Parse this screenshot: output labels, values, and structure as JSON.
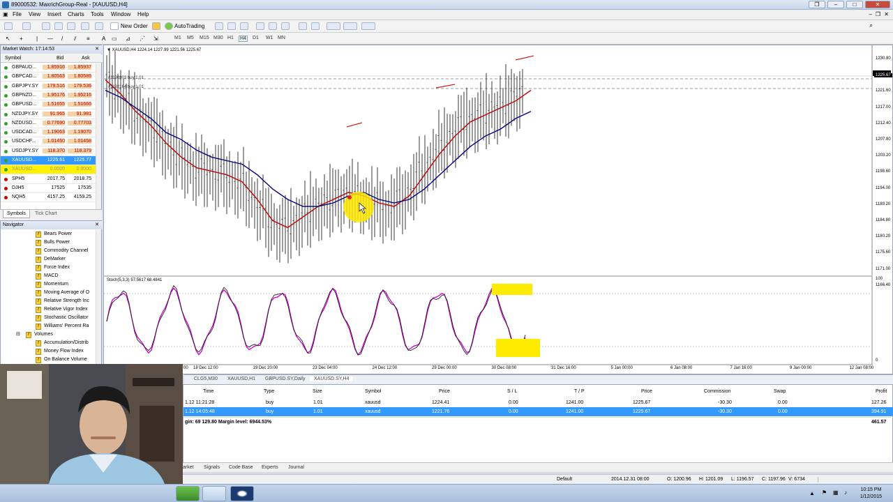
{
  "window": {
    "title": "89000532: MaxrichGroup-Real - [XAUUSD,H4]"
  },
  "menu": [
    "File",
    "View",
    "Insert",
    "Charts",
    "Tools",
    "Window",
    "Help"
  ],
  "toolbar": {
    "new_order": "New Order",
    "autotrading": "AutoTrading"
  },
  "timeframes": [
    "M1",
    "M5",
    "M15",
    "M30",
    "H1",
    "H4",
    "D1",
    "W1",
    "MN"
  ],
  "market_watch": {
    "title": "Market Watch: 17:14:53",
    "columns": [
      "Symbol",
      "Bid",
      "Ask"
    ],
    "rows": [
      {
        "symbol": "GBPAUD...",
        "bid": "1.85916",
        "ask": "1.85937"
      },
      {
        "symbol": "GBPCAD...",
        "bid": "1.80563",
        "ask": "1.80586"
      },
      {
        "symbol": "GBPJPY.SY",
        "bid": "179.516",
        "ask": "179.536"
      },
      {
        "symbol": "GBPNZD...",
        "bid": "1.95176",
        "ask": "1.95216"
      },
      {
        "symbol": "GBPUSD...",
        "bid": "1.51655",
        "ask": "1.51666"
      },
      {
        "symbol": "NZDJPY.SY",
        "bid": "91.965",
        "ask": "91.981"
      },
      {
        "symbol": "NZDUSD...",
        "bid": "0.77690",
        "ask": "0.77703"
      },
      {
        "symbol": "USDCAD...",
        "bid": "1.19063",
        "ask": "1.19070"
      },
      {
        "symbol": "USDCHF...",
        "bid": "1.01450",
        "ask": "1.01458"
      },
      {
        "symbol": "USDJPY.SY",
        "bid": "118.370",
        "ask": "118.379"
      },
      {
        "symbol": "XAUUSD...",
        "bid": "1225.61",
        "ask": "1225.77"
      },
      {
        "symbol": "XAUUSD...",
        "bid": "0.0000",
        "ask": "0.0000"
      },
      {
        "symbol": "SPH5",
        "bid": "2017.75",
        "ask": "2018.75"
      },
      {
        "symbol": "DJH5",
        "bid": "17525",
        "ask": "17535"
      },
      {
        "symbol": "NQH5",
        "bid": "4157.25",
        "ask": "4159.25"
      }
    ],
    "tabs": [
      "Symbols",
      "Tick Chart"
    ]
  },
  "navigator": {
    "title": "Navigator",
    "items": [
      "Bears Power",
      "Bulls Power",
      "Commodity Channel",
      "DeMarker",
      "Force Index",
      "MACD",
      "Momentum",
      "Moving Average of O",
      "Relative Strength Inc",
      "Relative Vigor Index",
      "Stochastic Oscillator",
      "Williams' Percent Ra"
    ],
    "group": "Volumes",
    "volume_items": [
      "Accumulation/Distrib",
      "Money Flow Index",
      "On Balance Volume"
    ]
  },
  "chart": {
    "header": "XAUUSD,H4  1224.14 1227.99 1221.56 1225.67",
    "orders": [
      "#1190903 buy 1.01",
      "#1192164 buy 1.01"
    ],
    "current_price": "1225.67",
    "price_ticks": [
      "1230.80",
      "1226.40",
      "1221.60",
      "1217.00",
      "1212.40",
      "1207.80",
      "1203.20",
      "1198.60",
      "1194.00",
      "1189.20",
      "1184.80",
      "1180.20",
      "1175.60",
      "1171.00",
      "1166.40"
    ],
    "stoch_header": "Stoch(5,3,3) 57.5617 68.4841",
    "stoch_ticks": [
      "100",
      "0"
    ],
    "time_ticks": [
      "18 Dec 12:00",
      "19 Dec 20:00",
      "23 Dec 04:00",
      "24 Dec 12:00",
      "29 Dec 00:00",
      "30 Dec 08:00",
      "31 Dec 16:00",
      "5 Jan 00:00",
      "6 Jan 08:00",
      "7 Jan 16:00",
      "9 Jan 00:00",
      "12 Jan 08:00"
    ],
    "time_prefix": "00",
    "tabs": [
      "CLG5,M30",
      "XAUUSD,H1",
      "GBPUSD.SY,Daily",
      "XAUUSD.SY,H4"
    ]
  },
  "chart_data": {
    "type": "line",
    "title": "XAUUSD,H4",
    "ylim": [
      1166.4,
      1230.8
    ],
    "series": [
      {
        "name": "",
        "color": "#c00000",
        "values": [
          1222,
          1218,
          1213,
          1209,
          1204,
          1200,
          1197,
          1196,
          1195,
          1193,
          1188,
          1182,
          1180,
          1183,
          1186,
          1188,
          1190,
          1189,
          1187,
          1186,
          1189,
          1195,
          1201,
          1206,
          1210,
          1212,
          1214,
          1216,
          1219
        ]
      },
      {
        "name": "",
        "color": "#000080",
        "values": [
          1219,
          1217,
          1214,
          1211,
          1207,
          1205,
          1202,
          1200,
          1199,
          1198,
          1195,
          1191,
          1188,
          1186,
          1186,
          1187,
          1189,
          1190,
          1188,
          1187,
          1188,
          1191,
          1195,
          1199,
          1203,
          1206,
          1208,
          1211,
          1213
        ]
      }
    ]
  },
  "terminal": {
    "columns": [
      "Time",
      "Type",
      "Size",
      "Symbol",
      "Price",
      "S / L",
      "T / P",
      "Price",
      "Commission",
      "Swap",
      "Profit"
    ],
    "rows": [
      {
        "time": "1.12 11:21:28",
        "type": "buy",
        "size": "1.01",
        "symbol": "xauusd",
        "price": "1224.41",
        "sl": "0.00",
        "tp": "1241.00",
        "cur": "1225.67",
        "commission": "-30.30",
        "swap": "0.00",
        "profit": "127.26"
      },
      {
        "time": "1.12 14:05:48",
        "type": "buy",
        "size": "1.01",
        "symbol": "xauusd",
        "price": "1221.76",
        "sl": "0.00",
        "tp": "1241.00",
        "cur": "1225.67",
        "commission": "-30.30",
        "swap": "0.00",
        "profit": "394.91"
      }
    ],
    "summary": "gin: 69 129.80  Margin level: 6944.53%",
    "total": "461.57",
    "tabs": [
      "arket",
      "Signals",
      "Code Base",
      "Experts",
      "Journal"
    ]
  },
  "status": {
    "profile": "Default",
    "time": "2014.12.31 08:00",
    "open": "O: 1200.96",
    "high": "H: 1201.09",
    "low": "L: 1196.57",
    "close": "C: 1197.96",
    "volume": "V: 6734"
  },
  "clock": {
    "time": "10:15 PM",
    "date": "1/12/2015"
  },
  "colors": {
    "highlight_row": "#3399ff",
    "bid_red": "#c00000",
    "ma_red": "#c00000",
    "ma_blue": "#000080",
    "stoch": "#cc00cc",
    "annotation": "#ffeb00"
  }
}
